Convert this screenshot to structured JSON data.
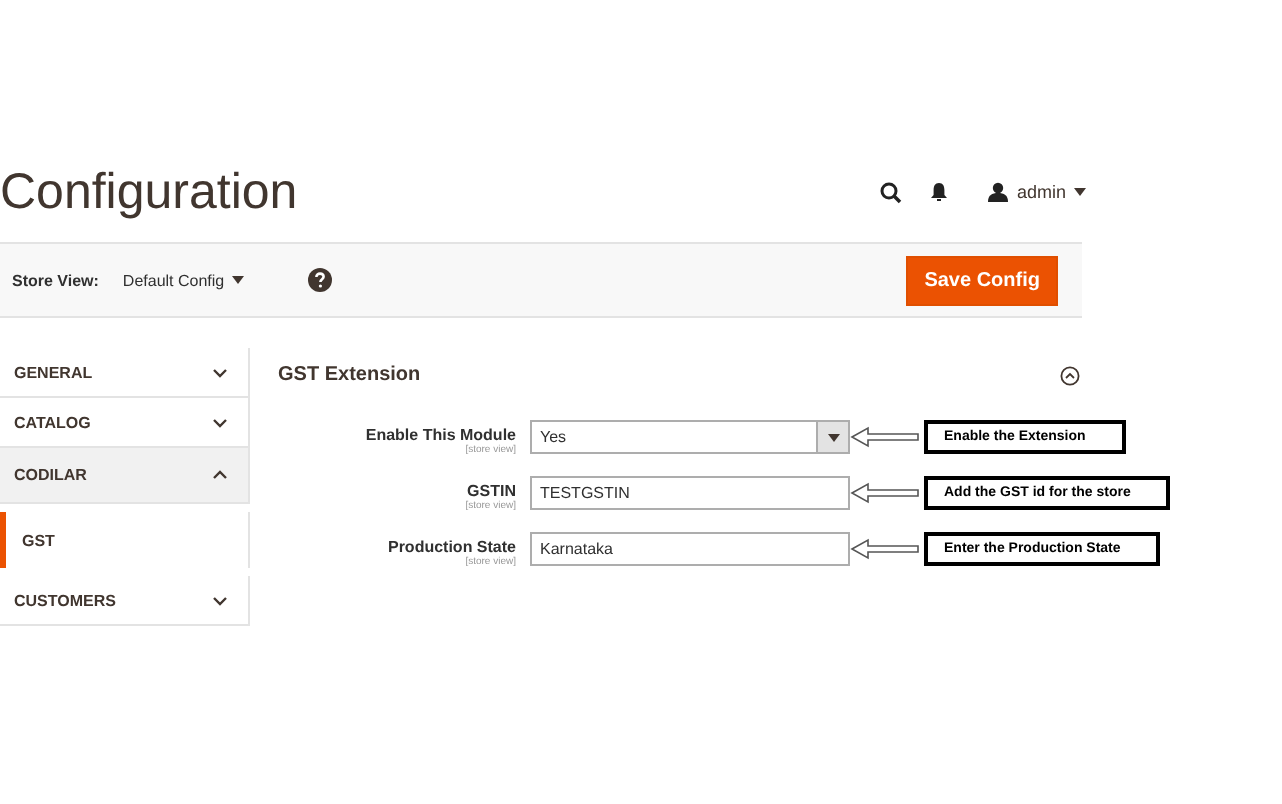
{
  "page_title": "Configuration",
  "header": {
    "user": "admin"
  },
  "toolbar": {
    "store_view_label": "Store View:",
    "store_view_value": "Default Config",
    "save_button": "Save Config"
  },
  "sidebar": {
    "items": [
      {
        "label": "GENERAL",
        "expanded": false
      },
      {
        "label": "CATALOG",
        "expanded": false
      },
      {
        "label": "CODILAR",
        "expanded": true,
        "children": [
          {
            "label": "GST",
            "selected": true
          }
        ]
      },
      {
        "label": "CUSTOMERS",
        "expanded": false
      }
    ]
  },
  "section": {
    "title": "GST Extension",
    "expanded": true,
    "fields": [
      {
        "kind": "select",
        "label": "Enable This Module",
        "scope": "[store view]",
        "value": "Yes",
        "annotation": "Enable the Extension"
      },
      {
        "kind": "text",
        "label": "GSTIN",
        "scope": "[store view]",
        "value": "TESTGSTIN",
        "annotation": "Add the GST id for the store"
      },
      {
        "kind": "text",
        "label": "Production State",
        "scope": "[store view]",
        "value": "Karnataka",
        "annotation": "Enter the Production State"
      }
    ]
  }
}
